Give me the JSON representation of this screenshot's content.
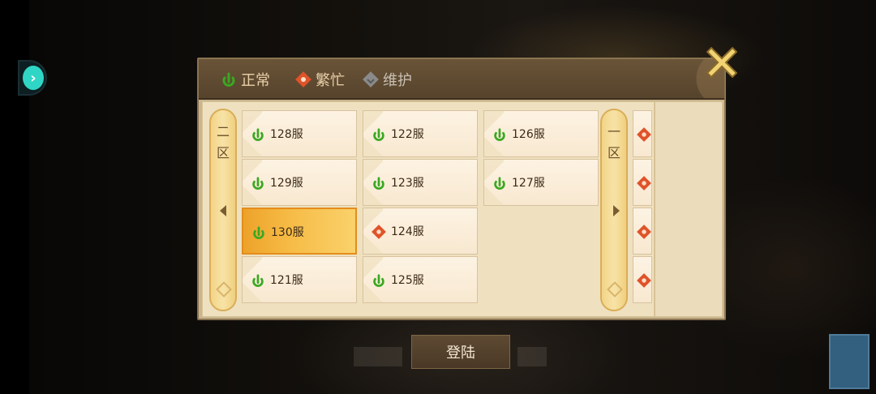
{
  "legend": {
    "normal": "正常",
    "busy": "繁忙",
    "maintenance": "维护"
  },
  "zones": {
    "left_label": "二区",
    "right_label": "一区"
  },
  "servers": [
    {
      "name": "128服",
      "status": "normal"
    },
    {
      "name": "129服",
      "status": "normal"
    },
    {
      "name": "130服",
      "status": "normal",
      "selected": true
    },
    {
      "name": "121服",
      "status": "normal"
    },
    {
      "name": "122服",
      "status": "normal"
    },
    {
      "name": "123服",
      "status": "normal"
    },
    {
      "name": "124服",
      "status": "busy"
    },
    {
      "name": "125服",
      "status": "normal"
    },
    {
      "name": "126服",
      "status": "normal"
    },
    {
      "name": "127服",
      "status": "normal"
    }
  ],
  "login_label": "登陆",
  "colors": {
    "normal": "#3aa822",
    "busy": "#e0532a",
    "maintenance": "#8a8a8a",
    "selected": "#f6bb45",
    "accent": "#2fd6c6"
  }
}
